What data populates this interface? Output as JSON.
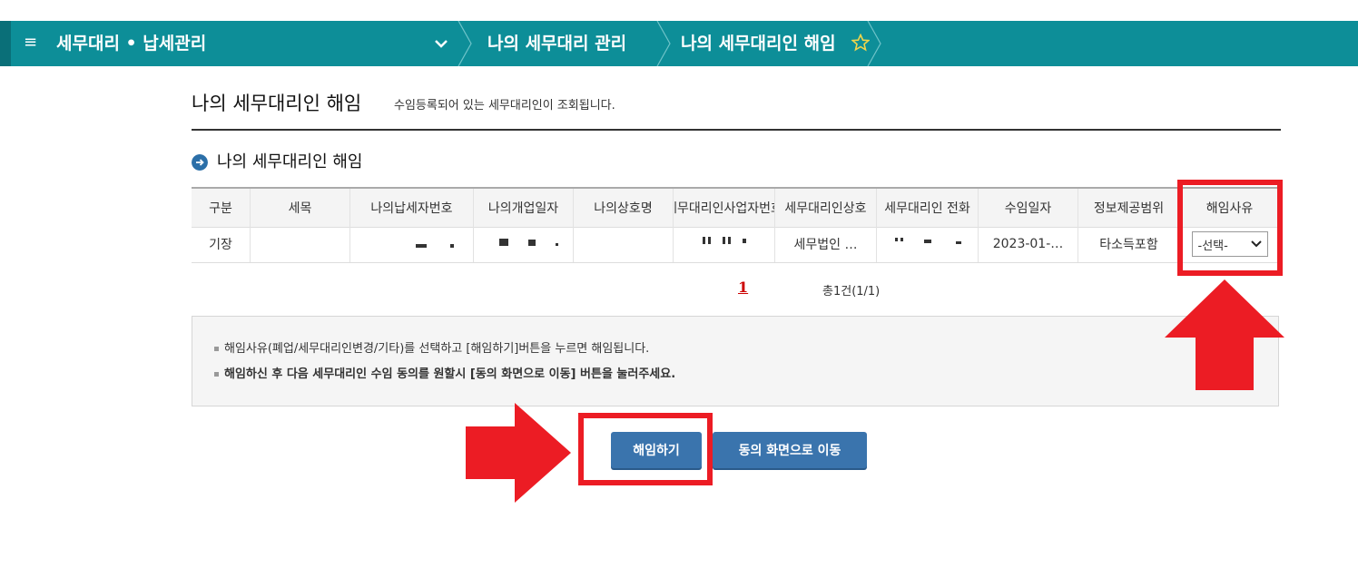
{
  "topbar": {
    "menu_icon": "≡",
    "brand": "세무대리 • 납세관리",
    "breadcrumbs": [
      "나의 세무대리 관리",
      "나의 세무대리인 해임"
    ]
  },
  "page": {
    "title": "나의 세무대리인 해임",
    "description": "수임등록되어 있는 세무대리인이 조회됩니다."
  },
  "section": {
    "title": "나의 세무대리인 해임"
  },
  "table": {
    "headers": [
      "구분",
      "세목",
      "나의납세자번호",
      "나의개업일자",
      "나의상호명",
      "세무대리인사업자번호",
      "세무대리인상호",
      "세무대리인 전화",
      "수임일자",
      "정보제공범위",
      "해임사유"
    ],
    "row": {
      "type": "기장",
      "tax_item": "",
      "firm_name": "세무법인 …",
      "accept_date": "2023-01-…",
      "scope": "타소득포함",
      "reason_select": "-선택-"
    }
  },
  "pager": {
    "current": "1",
    "total": "총1건(1/1)"
  },
  "notice": {
    "line1": "해임사유(폐업/세무대리인변경/기타)를 선택하고 [해임하기]버튼을 누르면 해임됩니다.",
    "line2": "해임하신 후 다음 세무대리인 수임 동의를 원할시 [동의 화면으로 이동] 버튼을 눌러주세요."
  },
  "buttons": {
    "dismiss": "해임하기",
    "go_consent": "동의 화면으로 이동"
  },
  "colors": {
    "topbar": "#0d8e98",
    "button": "#3a74ad",
    "highlight": "#ec1c24",
    "pager": "#cc0000"
  }
}
